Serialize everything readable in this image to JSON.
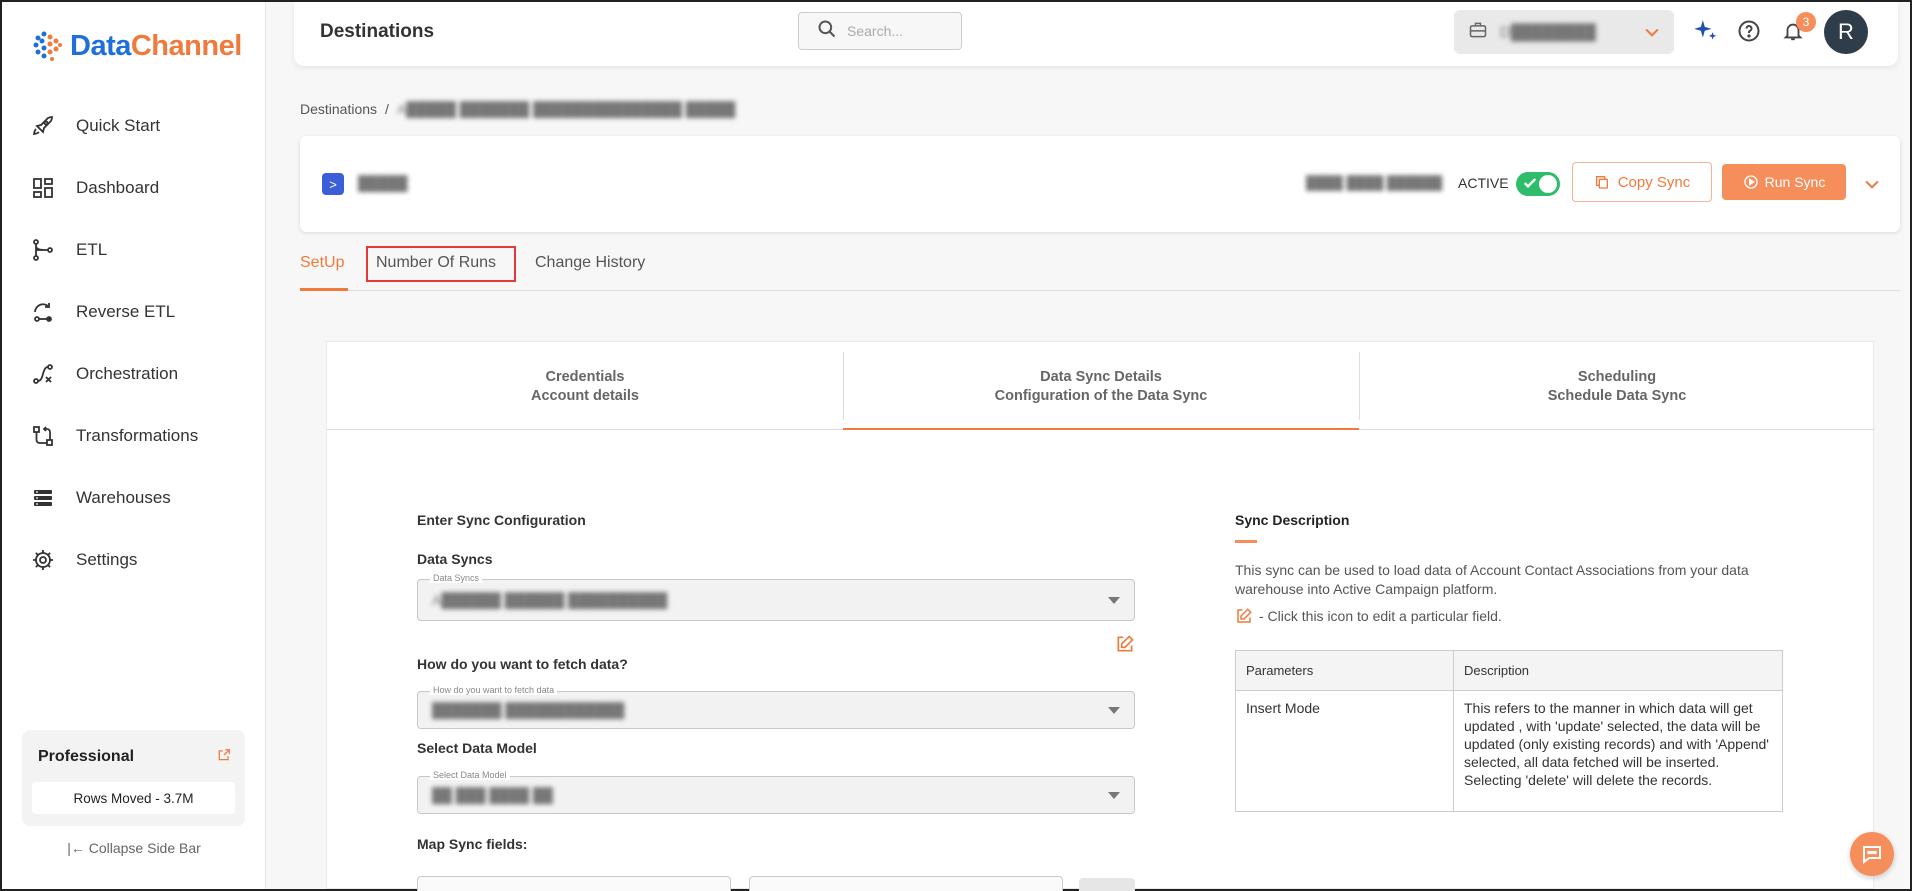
{
  "brand": {
    "name_part1": "Data",
    "name_part2": "Channel"
  },
  "sidebar": {
    "items": [
      {
        "label": "Quick Start",
        "icon": "rocket-icon"
      },
      {
        "label": "Dashboard",
        "icon": "dashboard-icon"
      },
      {
        "label": "ETL",
        "icon": "etl-icon"
      },
      {
        "label": "Reverse ETL",
        "icon": "reverse-etl-icon"
      },
      {
        "label": "Orchestration",
        "icon": "orchestration-icon"
      },
      {
        "label": "Transformations",
        "icon": "transformations-icon"
      },
      {
        "label": "Warehouses",
        "icon": "warehouses-icon"
      },
      {
        "label": "Settings",
        "icon": "gear-icon"
      }
    ],
    "plan": {
      "title": "Professional",
      "rows_moved": "Rows Moved - 3.7M"
    },
    "collapse_label": "Collapse Side Bar"
  },
  "header": {
    "title": "Destinations",
    "search_placeholder": "Search...",
    "workspace_name": "D████████",
    "notification_count": "3",
    "avatar_initial": "R"
  },
  "breadcrumb": {
    "root": "Destinations",
    "separator": "/",
    "current": "A█████ ███████ ███████████████ █████"
  },
  "sync": {
    "name": "█████",
    "updated": "████ ████ ██████",
    "status": "ACTIVE",
    "copy_label": "Copy Sync",
    "run_label": "Run Sync"
  },
  "tabs": [
    {
      "label": "SetUp",
      "active": true
    },
    {
      "label": "Number Of Runs",
      "active": false
    },
    {
      "label": "Change History",
      "active": false
    }
  ],
  "steps": [
    {
      "title": "Credentials",
      "subtitle": "Account details"
    },
    {
      "title": "Data Sync Details",
      "subtitle": "Configuration of the Data Sync"
    },
    {
      "title": "Scheduling",
      "subtitle": "Schedule Data Sync"
    }
  ],
  "form": {
    "heading": "Enter Sync Configuration",
    "data_syncs_label": "Data Syncs",
    "data_syncs_floating": "Data Syncs",
    "data_syncs_value": "A██████ ██████ ██████████",
    "fetch_label": "How do you want to fetch data?",
    "fetch_floating": "How do you want to fetch data",
    "fetch_value": "███████ ████████████",
    "model_label": "Select Data Model",
    "model_floating": "Select Data Model",
    "model_value": "██ ███ ████ ██",
    "map_label": "Map Sync fields:"
  },
  "description": {
    "title": "Sync Description",
    "text": "This sync can be used to load data of Account Contact Associations from your data warehouse into Active Campaign platform.",
    "hint": "- Click this icon to edit a particular field.",
    "table_headers": [
      "Parameters",
      "Description"
    ],
    "table_rows": [
      [
        "Insert Mode",
        "This refers to the manner in which data will get updated , with 'update' selected, the data will be updated (only existing records) and with 'Append' selected, all data fetched will be inserted. Selecting 'delete' will delete the records."
      ]
    ]
  },
  "colors": {
    "accent": "#f07a3c",
    "brand_blue": "#1e6fd9",
    "toggle_on": "#2ebd6b"
  }
}
